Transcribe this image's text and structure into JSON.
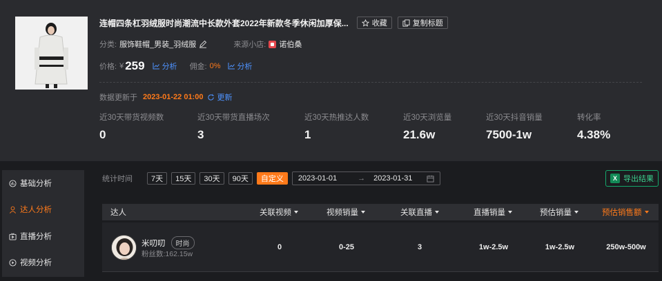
{
  "product": {
    "title": "连帽四条杠羽绒服时尚潮流中长款外套2022年新款冬季休闲加厚保...",
    "favorite_label": "收藏",
    "copy_title_label": "复制标题",
    "category_label": "分类:",
    "category_value": "服饰鞋帽_男装_羽绒服",
    "source_label": "来源小店:",
    "source_value": "诺伯桑",
    "price_label": "价格:",
    "currency": "¥",
    "price": "259",
    "analysis_label": "分析",
    "commission_label": "佣金:",
    "commission_value": "0%"
  },
  "update": {
    "label": "数据更新于",
    "time": "2023-01-22 01:00",
    "refresh_label": "更新"
  },
  "stats": [
    {
      "label": "近30天带货视频数",
      "value": "0"
    },
    {
      "label": "近30天带货直播场次",
      "value": "3"
    },
    {
      "label": "近30天热推达人数",
      "value": "1"
    },
    {
      "label": "近30天浏览量",
      "value": "21.6w"
    },
    {
      "label": "近30天抖音销量",
      "value": "7500-1w"
    },
    {
      "label": "转化率",
      "value": "4.38%"
    }
  ],
  "sidebar": {
    "items": [
      {
        "label": "基础分析",
        "icon": "stats-icon",
        "active": false
      },
      {
        "label": "达人分析",
        "icon": "person-icon",
        "active": true
      },
      {
        "label": "直播分析",
        "icon": "live-icon",
        "active": false
      },
      {
        "label": "视频分析",
        "icon": "play-icon",
        "active": false
      }
    ]
  },
  "filter": {
    "label": "统计时间",
    "ranges": [
      "7天",
      "15天",
      "30天",
      "90天",
      "自定义"
    ],
    "active_range": "自定义",
    "start_date": "2023-01-01",
    "end_date": "2023-01-31",
    "arrow": "→"
  },
  "export": {
    "label": "导出结果",
    "icon_text": "X"
  },
  "table": {
    "headers": [
      "达人",
      "关联视频",
      "视频销量",
      "关联直播",
      "直播销量",
      "预估销量",
      "预估销售额"
    ],
    "rows": [
      {
        "name": "米叨叨",
        "tag": "时尚",
        "fans": "粉丝数:162.15w",
        "related_videos": "0",
        "video_sales": "0-25",
        "related_lives": "3",
        "live_sales": "1w-2.5w",
        "estimated_sales": "1w-2.5w",
        "estimated_revenue": "250w-500w"
      }
    ]
  },
  "colors": {
    "accent": "#ff7a1a",
    "link": "#4e93ff",
    "export": "#3cd08f",
    "background": "#1b1c1f",
    "panel": "#2a2b2f"
  }
}
